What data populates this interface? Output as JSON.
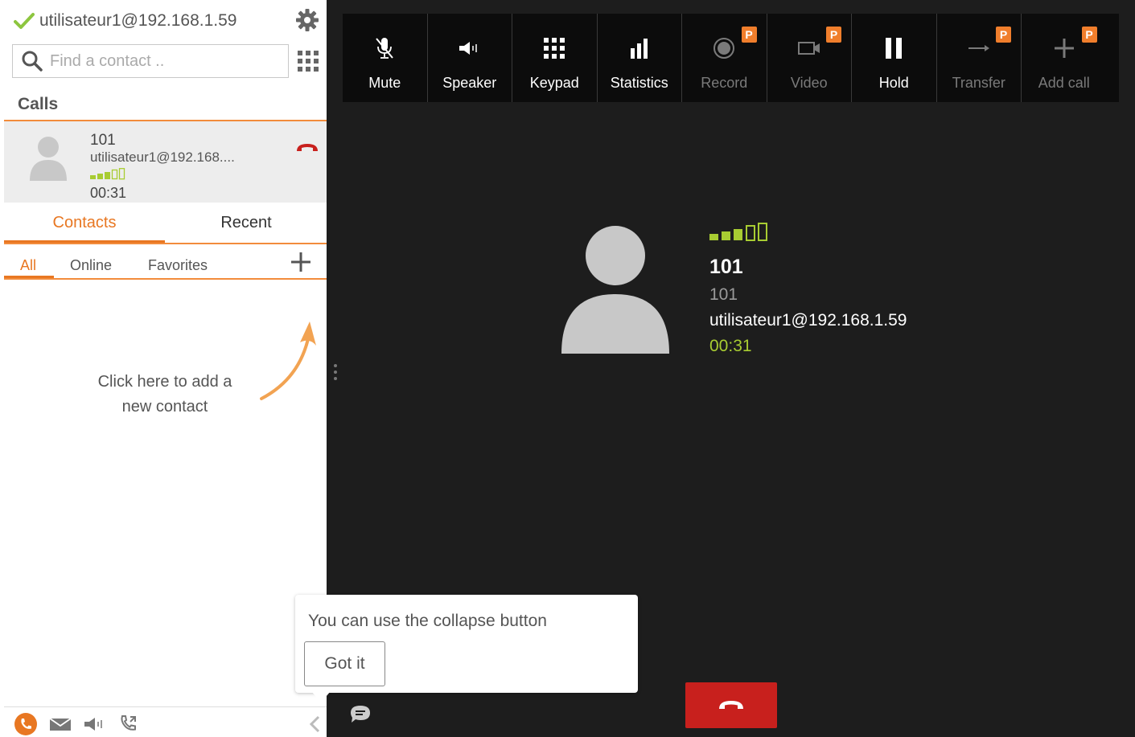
{
  "account": {
    "status_icon": "check-icon",
    "label": "utilisateur1@192.168.1.59",
    "status_color": "#8dc63f"
  },
  "search": {
    "placeholder": "Find a contact .."
  },
  "calls": {
    "title": "Calls",
    "items": [
      {
        "number": "101",
        "uri": "utilisateur1@192.168....",
        "duration": "00:31",
        "signal_bars": 3
      }
    ]
  },
  "tabs": [
    {
      "label": "Contacts",
      "active": true
    },
    {
      "label": "Recent",
      "active": false
    }
  ],
  "subtabs": [
    {
      "label": "All",
      "active": true
    },
    {
      "label": "Online",
      "active": false
    },
    {
      "label": "Favorites",
      "active": false
    }
  ],
  "hint": {
    "line1": "Click here to add a",
    "line2": "new contact"
  },
  "toolbar": [
    {
      "label": "Mute",
      "icon": "mute-icon",
      "enabled": true,
      "premium": false
    },
    {
      "label": "Speaker",
      "icon": "speaker-icon",
      "enabled": true,
      "premium": false
    },
    {
      "label": "Keypad",
      "icon": "keypad-icon",
      "enabled": true,
      "premium": false
    },
    {
      "label": "Statistics",
      "icon": "statistics-icon",
      "enabled": true,
      "premium": false
    },
    {
      "label": "Record",
      "icon": "record-icon",
      "enabled": false,
      "premium": true
    },
    {
      "label": "Video",
      "icon": "video-icon",
      "enabled": false,
      "premium": true
    },
    {
      "label": "Hold",
      "icon": "hold-icon",
      "enabled": true,
      "premium": false
    },
    {
      "label": "Transfer",
      "icon": "transfer-icon",
      "enabled": false,
      "premium": true
    },
    {
      "label": "Add call",
      "icon": "add-call-icon",
      "enabled": false,
      "premium": true
    }
  ],
  "premium_badge": "P",
  "active_call": {
    "name": "101",
    "number": "101",
    "uri": "utilisateur1@192.168.1.59",
    "duration": "00:31",
    "signal_bars": 3
  },
  "tooltip": {
    "text": "You can use the collapse button",
    "button": "Got it"
  },
  "colors": {
    "accent": "#e87722",
    "hangup": "#c8201d",
    "signal": "#a8cc32",
    "badge": "#f07e2c",
    "dark_bg": "#1d1d1d"
  }
}
